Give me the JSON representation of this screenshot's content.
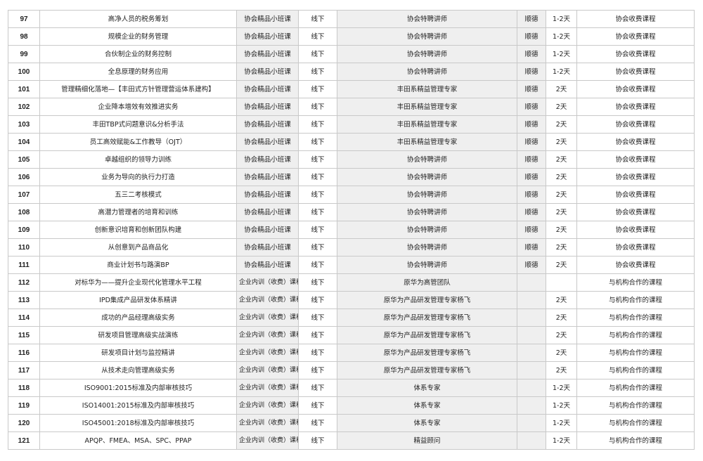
{
  "table": {
    "rows": [
      {
        "no": "97",
        "title": "高净人员的税务筹划",
        "category": "协会精品小班课",
        "mode": "线下",
        "lecturer": "协会特聘讲师",
        "location": "顺德",
        "duration": "1-2天",
        "fee": "协会收费课程"
      },
      {
        "no": "98",
        "title": "规模企业的财务管理",
        "category": "协会精品小班课",
        "mode": "线下",
        "lecturer": "协会特聘讲师",
        "location": "顺德",
        "duration": "1-2天",
        "fee": "协会收费课程"
      },
      {
        "no": "99",
        "title": "合伙制企业的财务控制",
        "category": "协会精品小班课",
        "mode": "线下",
        "lecturer": "协会特聘讲师",
        "location": "顺德",
        "duration": "1-2天",
        "fee": "协会收费课程"
      },
      {
        "no": "100",
        "title": "全息原理的财务应用",
        "category": "协会精品小班课",
        "mode": "线下",
        "lecturer": "协会特聘讲师",
        "location": "顺德",
        "duration": "1-2天",
        "fee": "协会收费课程"
      },
      {
        "no": "101",
        "title": "管理精细化落地—【丰田式方针管理营运体系建构】",
        "category": "协会精品小班课",
        "mode": "线下",
        "lecturer": "丰田系精益管理专家",
        "location": "顺德",
        "duration": "2天",
        "fee": "协会收费课程"
      },
      {
        "no": "102",
        "title": "企业降本增效有效推进实务",
        "category": "协会精品小班课",
        "mode": "线下",
        "lecturer": "丰田系精益管理专家",
        "location": "顺德",
        "duration": "2天",
        "fee": "协会收费课程"
      },
      {
        "no": "103",
        "title": "丰田TBP式问题意识&分析手法",
        "category": "协会精品小班课",
        "mode": "线下",
        "lecturer": "丰田系精益管理专家",
        "location": "顺德",
        "duration": "2天",
        "fee": "协会收费课程"
      },
      {
        "no": "104",
        "title": "员工高效赋能&工作教导（OJT）",
        "category": "协会精品小班课",
        "mode": "线下",
        "lecturer": "丰田系精益管理专家",
        "location": "顺德",
        "duration": "2天",
        "fee": "协会收费课程"
      },
      {
        "no": "105",
        "title": "卓越组织的领导力训练",
        "category": "协会精品小班课",
        "mode": "线下",
        "lecturer": "协会特聘讲师",
        "location": "顺德",
        "duration": "2天",
        "fee": "协会收费课程"
      },
      {
        "no": "106",
        "title": "业务为导向的执行力打造",
        "category": "协会精品小班课",
        "mode": "线下",
        "lecturer": "协会特聘讲师",
        "location": "顺德",
        "duration": "2天",
        "fee": "协会收费课程"
      },
      {
        "no": "107",
        "title": "五三二考核模式",
        "category": "协会精品小班课",
        "mode": "线下",
        "lecturer": "协会特聘讲师",
        "location": "顺德",
        "duration": "2天",
        "fee": "协会收费课程"
      },
      {
        "no": "108",
        "title": "高潜力管理者的培育和训练",
        "category": "协会精品小班课",
        "mode": "线下",
        "lecturer": "协会特聘讲师",
        "location": "顺德",
        "duration": "2天",
        "fee": "协会收费课程"
      },
      {
        "no": "109",
        "title": "创新意识培育和创新团队构建",
        "category": "协会精品小班课",
        "mode": "线下",
        "lecturer": "协会特聘讲师",
        "location": "顺德",
        "duration": "2天",
        "fee": "协会收费课程"
      },
      {
        "no": "110",
        "title": "从创意到产品商品化",
        "category": "协会精品小班课",
        "mode": "线下",
        "lecturer": "协会特聘讲师",
        "location": "顺德",
        "duration": "2天",
        "fee": "协会收费课程"
      },
      {
        "no": "111",
        "title": "商业计划书与路演BP",
        "category": "协会精品小班课",
        "mode": "线下",
        "lecturer": "协会特聘讲师",
        "location": "顺德",
        "duration": "2天",
        "fee": "协会收费课程"
      },
      {
        "no": "112",
        "title": "对标华为——提升企业现代化管理水平工程",
        "category": "企业内训（收费）课程",
        "mode": "线下",
        "lecturer": "原华为高管团队",
        "location": "",
        "duration": "",
        "fee": "与机构合作的课程"
      },
      {
        "no": "113",
        "title": "IPD集成产品研发体系精讲",
        "category": "企业内训（收费）课程",
        "mode": "线下",
        "lecturer": "原华为产品研发管理专家杨飞",
        "location": "",
        "duration": "2天",
        "fee": "与机构合作的课程"
      },
      {
        "no": "114",
        "title": "成功的产品经理高级实务",
        "category": "企业内训（收费）课程",
        "mode": "线下",
        "lecturer": "原华为产品研发管理专家杨飞",
        "location": "",
        "duration": "2天",
        "fee": "与机构合作的课程"
      },
      {
        "no": "115",
        "title": "研发项目管理高级实战演练",
        "category": "企业内训（收费）课程",
        "mode": "线下",
        "lecturer": "原华为产品研发管理专家杨飞",
        "location": "",
        "duration": "2天",
        "fee": "与机构合作的课程"
      },
      {
        "no": "116",
        "title": "研发项目计划与监控精讲",
        "category": "企业内训（收费）课程",
        "mode": "线下",
        "lecturer": "原华为产品研发管理专家杨飞",
        "location": "",
        "duration": "2天",
        "fee": "与机构合作的课程"
      },
      {
        "no": "117",
        "title": "从技术走向管理高级实务",
        "category": "企业内训（收费）课程",
        "mode": "线下",
        "lecturer": "原华为产品研发管理专家杨飞",
        "location": "",
        "duration": "2天",
        "fee": "与机构合作的课程"
      },
      {
        "no": "118",
        "title": "ISO9001:2015标准及内部审核技巧",
        "category": "企业内训（收费）课程",
        "mode": "线下",
        "lecturer": "体系专家",
        "location": "",
        "duration": "1-2天",
        "fee": "与机构合作的课程"
      },
      {
        "no": "119",
        "title": "ISO14001:2015标准及内部审核技巧",
        "category": "企业内训（收费）课程",
        "mode": "线下",
        "lecturer": "体系专家",
        "location": "",
        "duration": "1-2天",
        "fee": "与机构合作的课程"
      },
      {
        "no": "120",
        "title": "ISO45001:2018标准及内部审核技巧",
        "category": "企业内训（收费）课程",
        "mode": "线下",
        "lecturer": "体系专家",
        "location": "",
        "duration": "1-2天",
        "fee": "与机构合作的课程"
      },
      {
        "no": "121",
        "title": "APQP、FMEA、MSA、SPC、PPAP",
        "category": "企业内训（收费）课程",
        "mode": "线下",
        "lecturer": "精益顾问",
        "location": "",
        "duration": "1-2天",
        "fee": "与机构合作的课程"
      }
    ]
  }
}
